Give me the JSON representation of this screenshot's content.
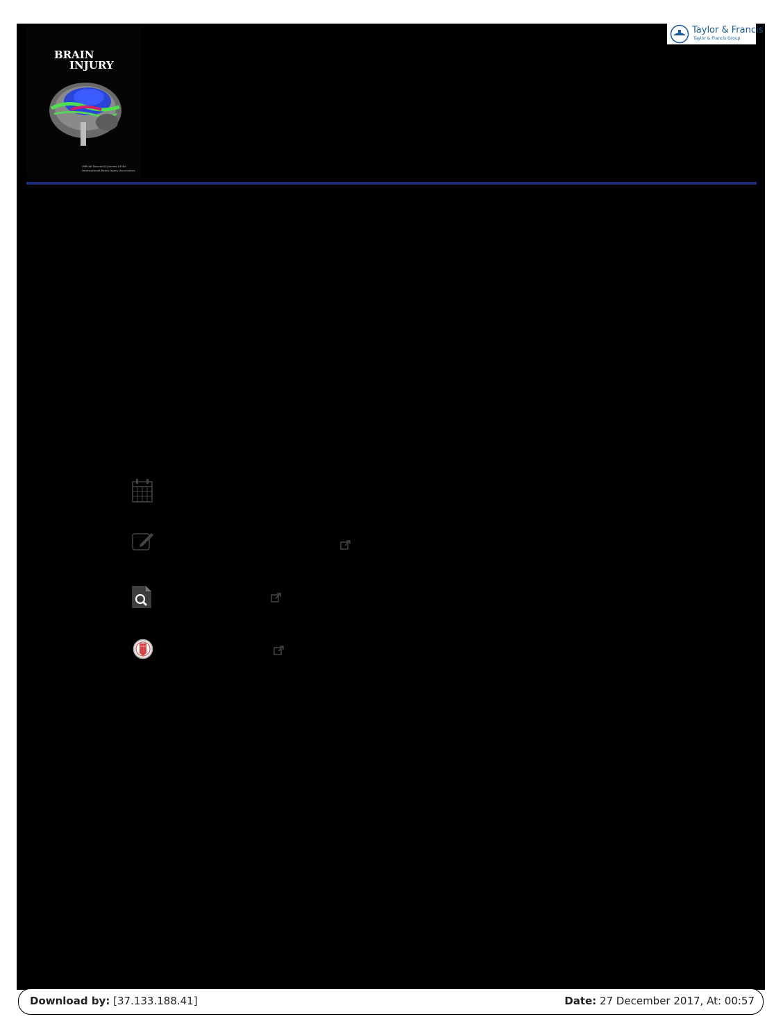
{
  "journal": {
    "title_line1": "BRAIN",
    "title_line2": "INJURY",
    "cover_footer": "Official Research Journal of the International Brain Injury Association"
  },
  "publisher": {
    "name": "Taylor & Francis",
    "group": "Taylor & Francis Group",
    "color": "#1b5b97"
  },
  "icons": [
    "calendar-icon",
    "submit-article-icon",
    "view-related-icon",
    "crossmark-icon",
    "external-link-icon"
  ],
  "footer": {
    "download_label": "Download by:",
    "download_value": "[37.133.188.41]",
    "date_label": "Date:",
    "date_value": "27 December 2017, At: 00:57"
  },
  "colors": {
    "rule": "#1e2a78",
    "page": "#000000"
  }
}
